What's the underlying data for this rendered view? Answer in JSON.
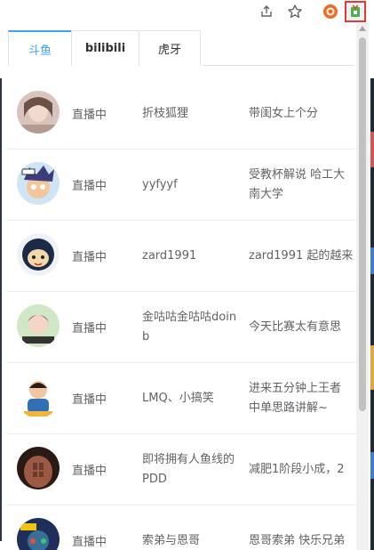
{
  "tabs": [
    "斗鱼",
    "bilibili",
    "虎牙"
  ],
  "active_tab": 0,
  "rows": [
    {
      "status": "直播中",
      "name": "折枝狐狸",
      "title": "带闺女上个分"
    },
    {
      "status": "直播中",
      "name": "yyfyyf",
      "title": "受教杯解说 哈工大 南大学"
    },
    {
      "status": "直播中",
      "name": "zard1991",
      "title": "zard1991 起的越来"
    },
    {
      "status": "直播中",
      "name": "金咕咕金咕咕doinb",
      "title": "今天比赛太有意思"
    },
    {
      "status": "直播中",
      "name": "LMQ、小搞笑",
      "title": "进来五分钟上王者 中单思路讲解~"
    },
    {
      "status": "直播中",
      "name": "即将拥有人鱼线的PDD",
      "title": "减肥1阶段小成，2"
    },
    {
      "status": "直播中",
      "name": "索弟与恩哥",
      "title": "恩哥索弟 快乐兄弟"
    }
  ],
  "colors": {
    "accent": "#409eff",
    "highlight": "#e53935"
  }
}
